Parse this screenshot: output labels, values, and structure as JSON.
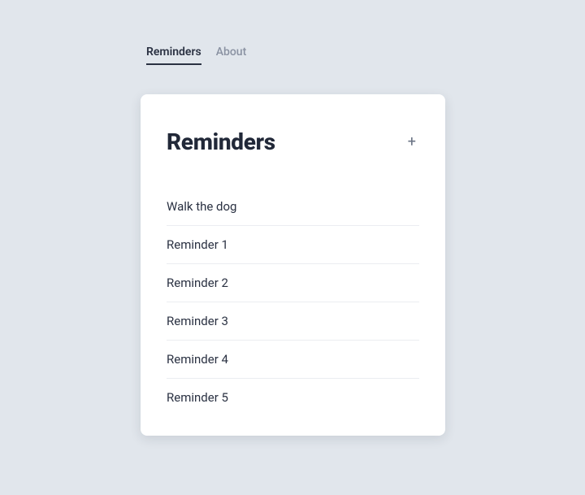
{
  "nav": {
    "items": [
      {
        "label": "Reminders",
        "active": true
      },
      {
        "label": "About",
        "active": false
      }
    ]
  },
  "card": {
    "title": "Reminders",
    "add_icon": "+"
  },
  "reminders": [
    {
      "text": "Walk the dog"
    },
    {
      "text": "Reminder 1"
    },
    {
      "text": "Reminder 2"
    },
    {
      "text": "Reminder 3"
    },
    {
      "text": "Reminder 4"
    },
    {
      "text": "Reminder 5"
    }
  ]
}
